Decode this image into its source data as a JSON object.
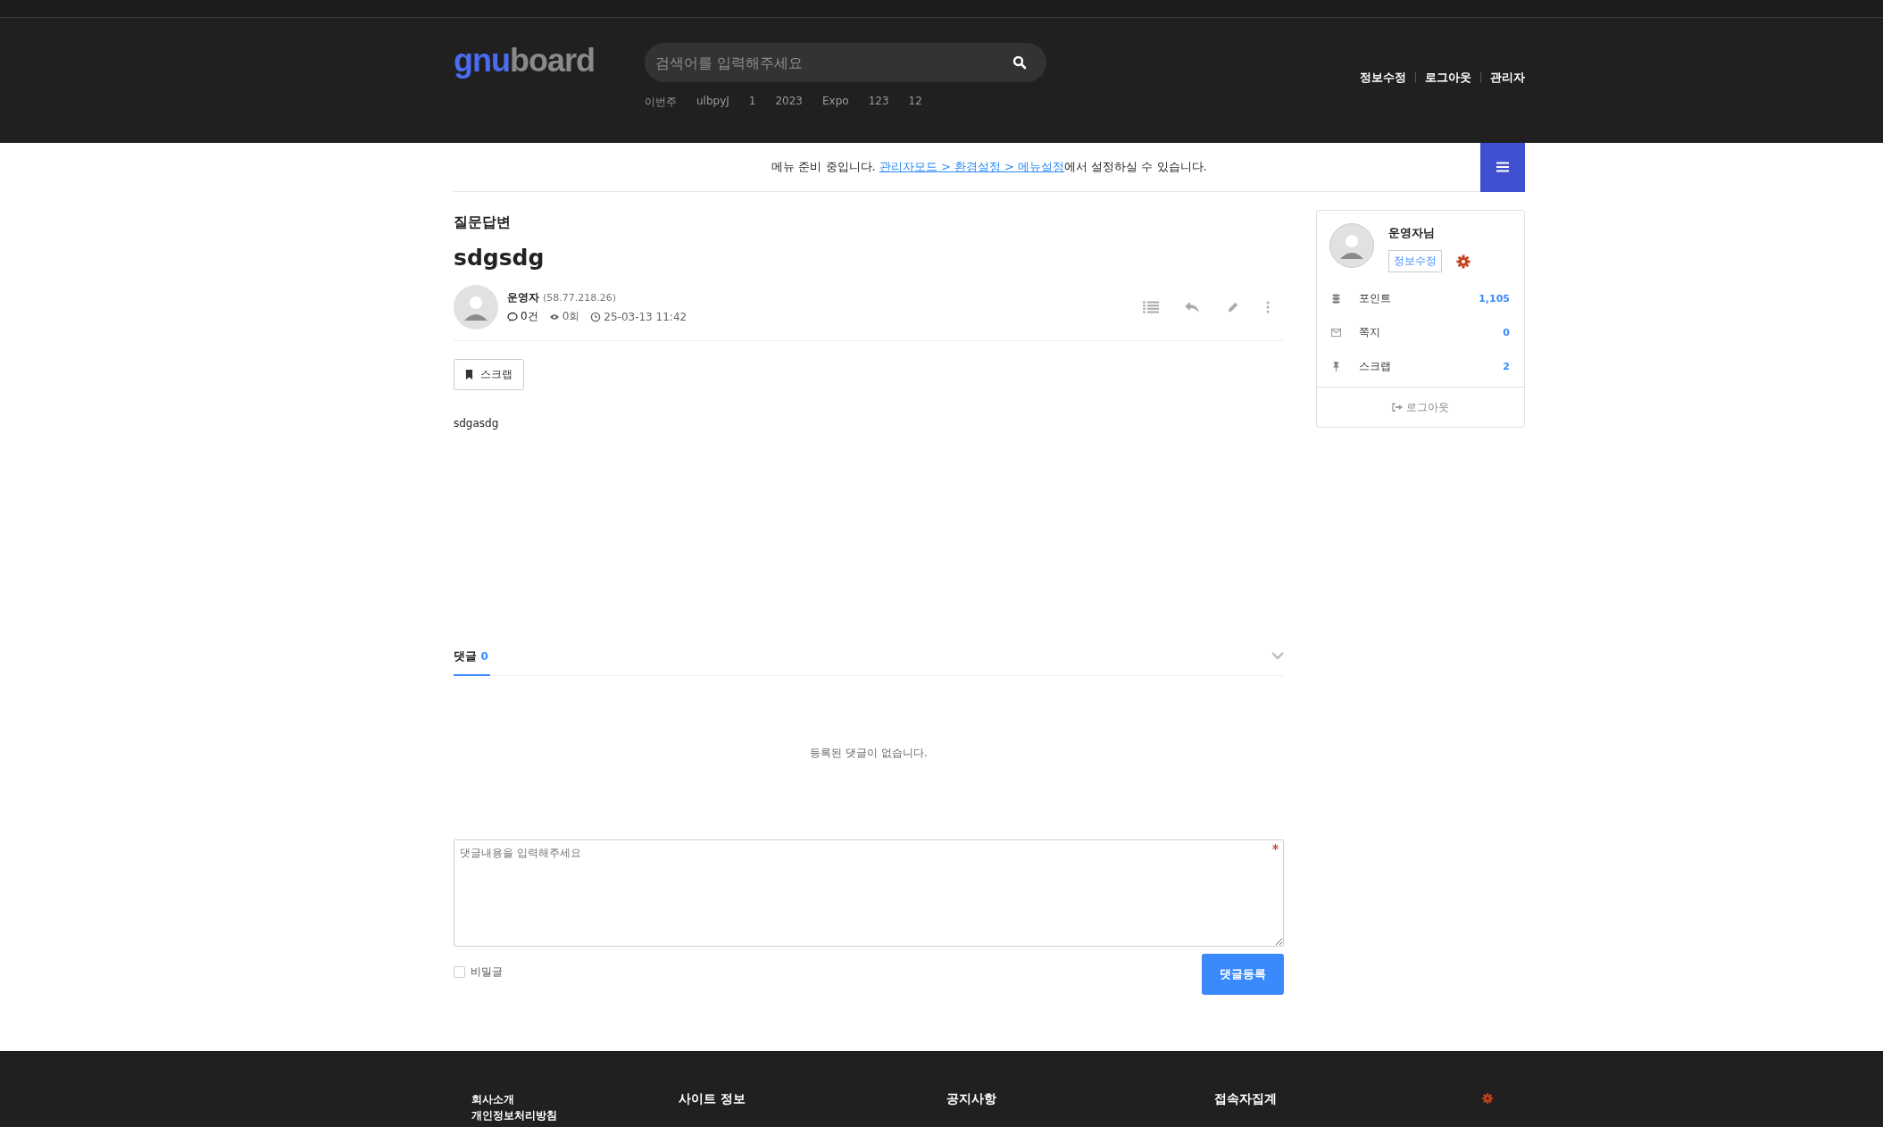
{
  "header": {
    "logo": {
      "accent": "gnu",
      "rest": "board"
    },
    "search": {
      "placeholder": "검색어를 입력해주세요"
    },
    "popular": [
      "이번주",
      "ulbpyJ",
      "1",
      "2023",
      "Expo",
      "123",
      "12"
    ],
    "links": [
      "정보수정",
      "로그아웃",
      "관리자"
    ]
  },
  "notice": {
    "before": "메뉴 준비 중입니다. ",
    "link": "관리자모드 > 환경설정 > 메뉴설정",
    "after": "에서 설정하실 수 있습니다."
  },
  "post": {
    "board": "질문답변",
    "title": "sdgsdg",
    "author": "운영자",
    "ip": "(58.77.218.26)",
    "comments": "0건",
    "views": "0회",
    "date": "25-03-13 11:42",
    "scrap": "스크랩",
    "body": "sdgasdg"
  },
  "comments": {
    "label": "댓글",
    "count": "0",
    "empty": "등록된 댓글이 없습니다.",
    "placeholder": "댓글내용을 입력해주세요",
    "secret": {
      "label": "비밀글",
      "checked": false
    },
    "submit": "댓글등록"
  },
  "sidebar": {
    "name": "운영자님",
    "edit": "정보수정",
    "rows": [
      {
        "kind": "points",
        "label": "포인트",
        "value": "1,105"
      },
      {
        "kind": "memo",
        "label": "쪽지",
        "value": "0"
      },
      {
        "kind": "scrap",
        "label": "스크랩",
        "value": "2"
      }
    ],
    "logout": "로그아웃"
  },
  "footer": {
    "links": [
      "회사소개",
      "개인정보처리방침"
    ],
    "sections": [
      "사이트 정보",
      "공지사항",
      "접속자집계"
    ]
  }
}
